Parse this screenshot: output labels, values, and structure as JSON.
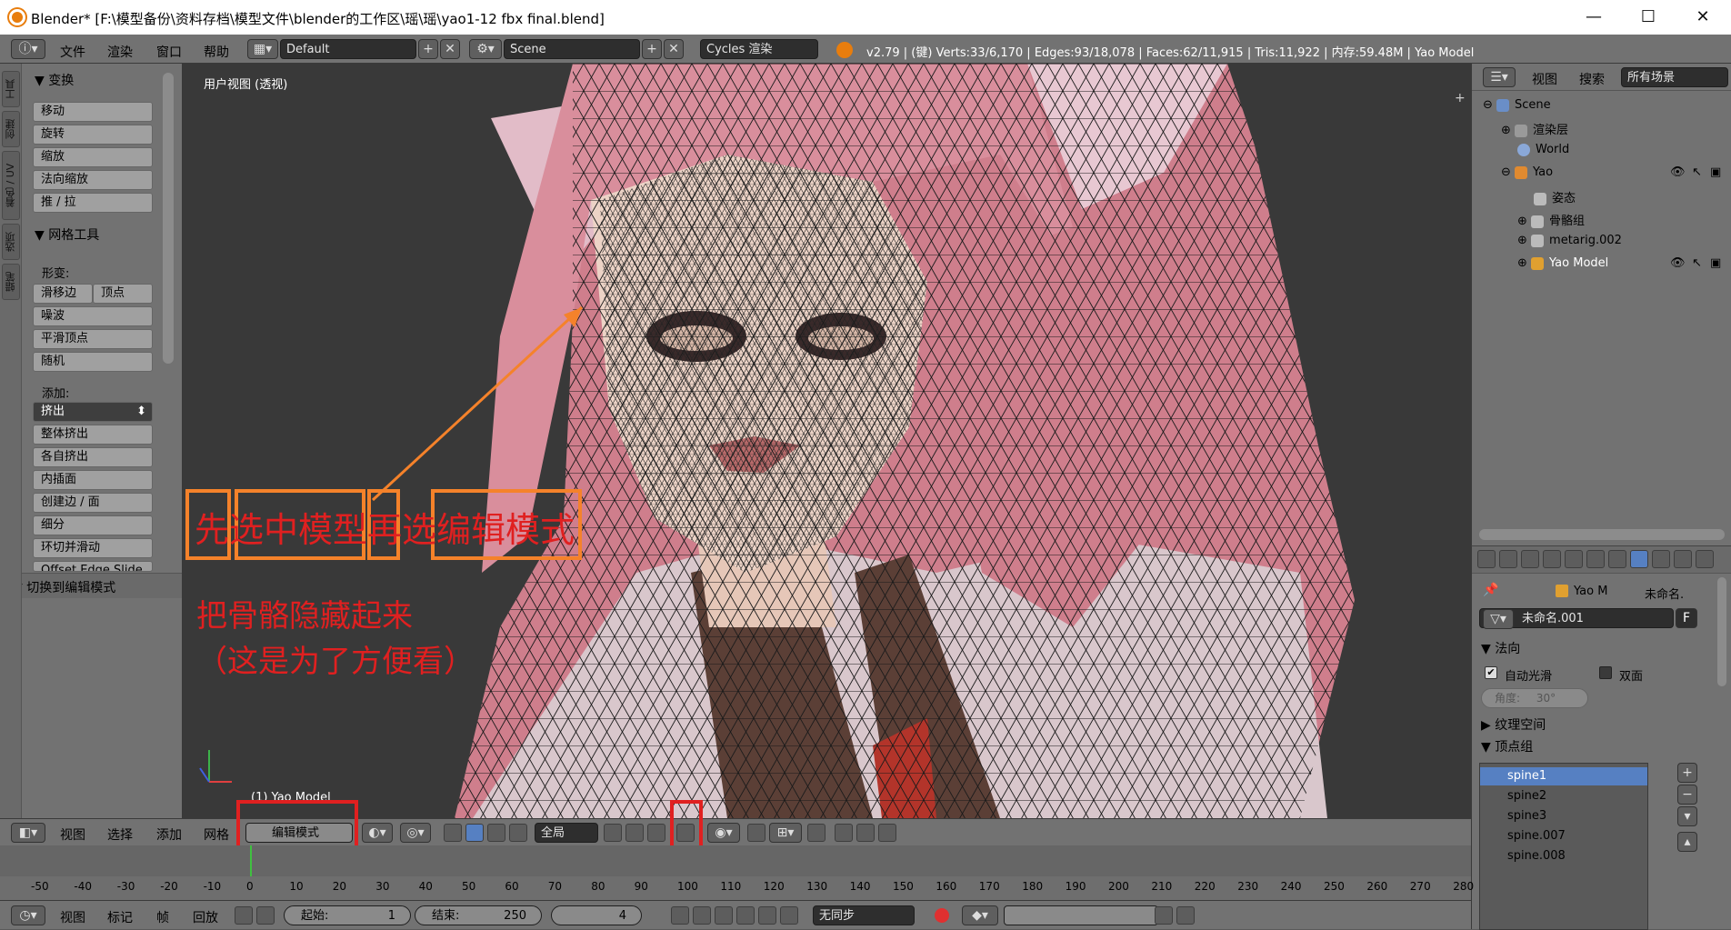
{
  "window": {
    "title": "Blender* [F:\\模型备份\\资料存档\\模型文件\\blender的工作区\\瑶\\瑶\\yao1-12 fbx final.blend]",
    "minimize": "—",
    "maximize": "☐",
    "close": "✕"
  },
  "menubar": {
    "menus": [
      "文件",
      "渲染",
      "窗口",
      "帮助"
    ],
    "layout": "Default",
    "scene": "Scene",
    "engine": "Cycles 渲染",
    "stats": "v2.79 | (键) Verts:33/6,170 | Edges:93/18,078 | Faces:62/11,915 | Tris:11,922 | 内存:59.48M | Yao Model"
  },
  "toolshelf": {
    "tabs": [
      "工具",
      "创建",
      "着色 / UV",
      "选项",
      "蜡笔"
    ],
    "transform": {
      "heading": "变换",
      "buttons": [
        "移动",
        "旋转",
        "缩放",
        "法向缩放",
        "推 / 拉"
      ]
    },
    "mesh_tools": {
      "heading": "网格工具",
      "deform_label": "形变:",
      "slide_edge": "滑移边",
      "vertex": "顶点",
      "buttons": [
        "噪波",
        "平滑顶点",
        "随机"
      ],
      "add_label": "添加:",
      "extrude": "挤出",
      "add_buttons": [
        "整体挤出",
        "各自挤出",
        "内插面",
        "创建边 / 面",
        "细分",
        "环切并滑动",
        "Offset Edge Slide"
      ]
    },
    "operator_panel": "切换到编辑模式"
  },
  "viewport": {
    "title": "用户视图 (透视)",
    "object_label": "(1) Yao Model",
    "annotation1": "先选中模型再选编辑模式",
    "annotation2": "把骨骼隐藏起来",
    "annotation3": "（这是为了方便看）"
  },
  "outliner": {
    "view": "视图",
    "search": "搜索",
    "filter": "所有场景",
    "items": [
      "Scene",
      "渲染层",
      "World",
      "Yao",
      "姿态",
      "骨骼组",
      "metarig.002",
      "Yao Model"
    ]
  },
  "properties": {
    "breadcrumb_obj": "Yao M",
    "breadcrumb_data": "未命名.",
    "datablock": "未命名.001",
    "datablock_f": "F",
    "normals_heading": "法向",
    "auto_smooth": "自动光滑",
    "double_sided": "双面",
    "angle": "角度:",
    "angle_value": "30°",
    "texspace": "纹理空间",
    "vgroups_heading": "顶点组",
    "vgroups": [
      "spine1",
      "spine2",
      "spine3",
      "spine.007",
      "spine.008"
    ]
  },
  "vpheader": {
    "menus": [
      "视图",
      "选择",
      "添加",
      "网格"
    ],
    "mode": "编辑模式",
    "orientation": "全局"
  },
  "timeline": {
    "ticks": [
      "-50",
      "-40",
      "-30",
      "-20",
      "-10",
      "0",
      "10",
      "20",
      "30",
      "40",
      "50",
      "60",
      "70",
      "80",
      "90",
      "100",
      "110",
      "120",
      "130",
      "140",
      "150",
      "160",
      "170",
      "180",
      "190",
      "200",
      "210",
      "220",
      "230",
      "240",
      "250",
      "260",
      "270",
      "280"
    ],
    "current": 1
  },
  "timelinebar": {
    "menus": [
      "视图",
      "标记",
      "帧",
      "回放"
    ],
    "start_label": "起始:",
    "start_value": "1",
    "end_label": "结束:",
    "end_value": "250",
    "current_value": "4",
    "sync": "无同步"
  }
}
